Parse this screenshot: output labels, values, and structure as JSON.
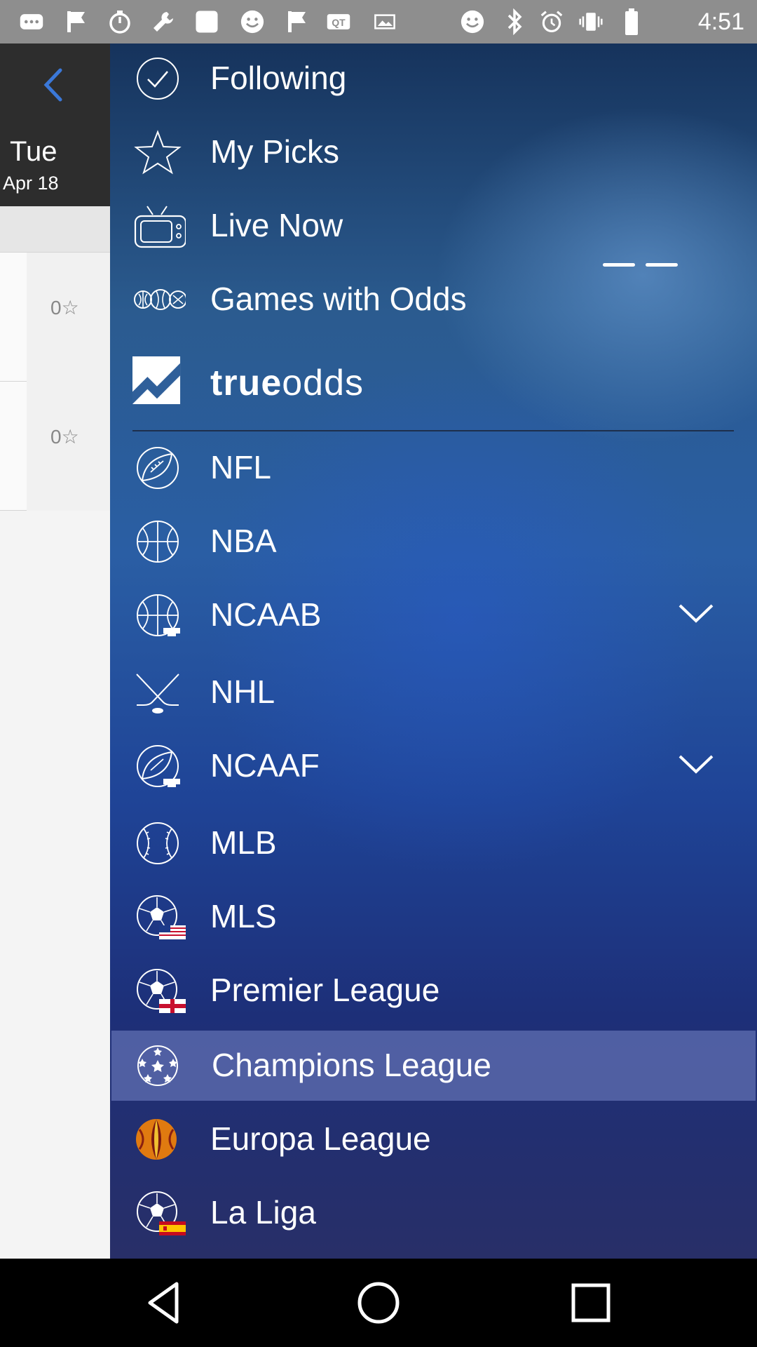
{
  "status_bar": {
    "time": "4:51",
    "icons": [
      "more-icon",
      "flag-icon",
      "timer-icon",
      "wrench-icon",
      "square-icon",
      "smiley-icon",
      "flag-icon",
      "qt-icon",
      "image-icon",
      "smiley-icon",
      "bluetooth-icon",
      "alarm-icon",
      "vibrate-icon",
      "battery-icon"
    ]
  },
  "left_panel": {
    "date": {
      "day": "Tue",
      "date": "Apr 18"
    },
    "games": [
      {
        "stars": "0☆"
      },
      {
        "stars": "0☆"
      }
    ]
  },
  "menu": {
    "items": [
      {
        "label": "Following",
        "icon": "checkmark-circle-icon"
      },
      {
        "label": "My Picks",
        "icon": "star-icon"
      },
      {
        "label": "Live Now",
        "icon": "tv-icon"
      },
      {
        "label": "Games with Odds",
        "icon": "odds-balls-icon"
      }
    ],
    "trueodds": {
      "part1": "true",
      "part2": "odds"
    },
    "leagues": [
      {
        "label": "NFL",
        "icon": "football-icon"
      },
      {
        "label": "NBA",
        "icon": "basketball-icon"
      },
      {
        "label": "NCAAB",
        "icon": "college-basketball-icon",
        "expandable": true
      },
      {
        "label": "NHL",
        "icon": "hockey-icon"
      },
      {
        "label": "NCAAF",
        "icon": "college-football-icon",
        "expandable": true
      },
      {
        "label": "MLB",
        "icon": "baseball-icon"
      },
      {
        "label": "MLS",
        "icon": "soccer-usa-icon"
      },
      {
        "label": "Premier League",
        "icon": "soccer-england-icon"
      },
      {
        "label": "Champions League",
        "icon": "champions-ball-icon",
        "selected": true
      },
      {
        "label": "Europa League",
        "icon": "europa-ball-icon"
      },
      {
        "label": "La Liga",
        "icon": "soccer-spain-icon"
      }
    ]
  },
  "colors": {
    "drawer_dark": "#16335c",
    "drawer_mid": "#2a5ea4",
    "drawer_bottom": "#282f68",
    "selected_bg": "#7887c8",
    "back_arrow": "#3b78d8"
  },
  "nav_bar": {
    "buttons": [
      "back-icon",
      "home-icon",
      "recents-icon"
    ]
  }
}
